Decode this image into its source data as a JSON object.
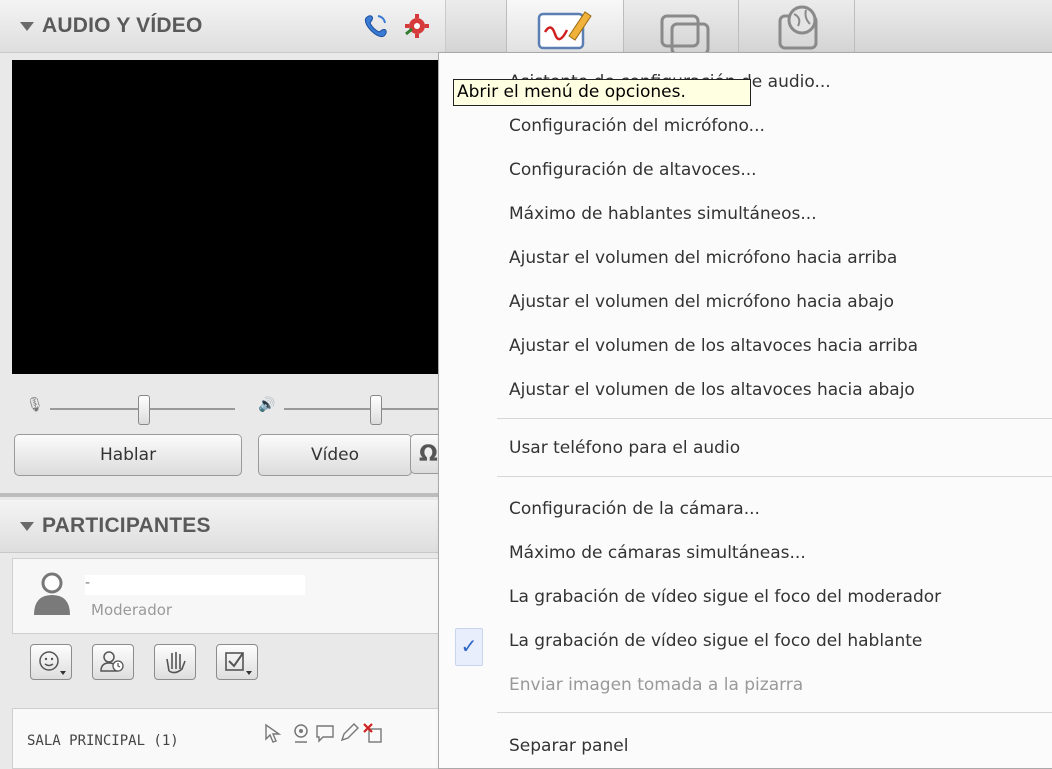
{
  "av_panel": {
    "title": "AUDIO Y VÍDEO",
    "talk_button": "Hablar",
    "video_button": "Vídeo",
    "extra_button_glyph": "Ω"
  },
  "participants_panel": {
    "title": "PARTICIPANTES",
    "participant": {
      "name": "-",
      "role": "Moderador"
    },
    "room_label": "SALA PRINCIPAL (1)"
  },
  "tabs": [
    {
      "name": "whiteboard"
    },
    {
      "name": "application-sharing"
    },
    {
      "name": "web-tour"
    }
  ],
  "tooltip": "Abrir el menú de opciones.",
  "menu": {
    "items": [
      {
        "label": "Asistente de configuración de audio...",
        "enabled": true
      },
      {
        "label": "Configuración del micrófono...",
        "enabled": true
      },
      {
        "label": "Configuración de altavoces...",
        "enabled": true
      },
      {
        "label": "Máximo de hablantes simultáneos...",
        "enabled": true
      },
      {
        "label": "Ajustar el volumen del micrófono hacia arriba",
        "enabled": true
      },
      {
        "label": "Ajustar el volumen del micrófono hacia abajo",
        "enabled": true
      },
      {
        "label": "Ajustar el volumen de los altavoces hacia arriba",
        "enabled": true
      },
      {
        "label": "Ajustar el volumen de los altavoces hacia abajo",
        "enabled": true
      },
      {
        "label": "Usar teléfono para el audio",
        "enabled": true
      },
      {
        "label": "Configuración de la cámara...",
        "enabled": true
      },
      {
        "label": "Máximo de cámaras simultáneas...",
        "enabled": true
      },
      {
        "label": "La grabación de vídeo sigue el foco del moderador",
        "enabled": true
      },
      {
        "label": "La grabación de vídeo sigue el foco del hablante",
        "enabled": true,
        "checked": true
      },
      {
        "label": "Enviar imagen tomada a la pizarra",
        "enabled": false
      },
      {
        "label": "Separar panel",
        "enabled": true
      }
    ],
    "check_glyph": "✓"
  },
  "colors": {
    "accent_blue": "#2f66c8",
    "tooltip_bg": "#ffffe1",
    "video_bg": "#000000"
  }
}
